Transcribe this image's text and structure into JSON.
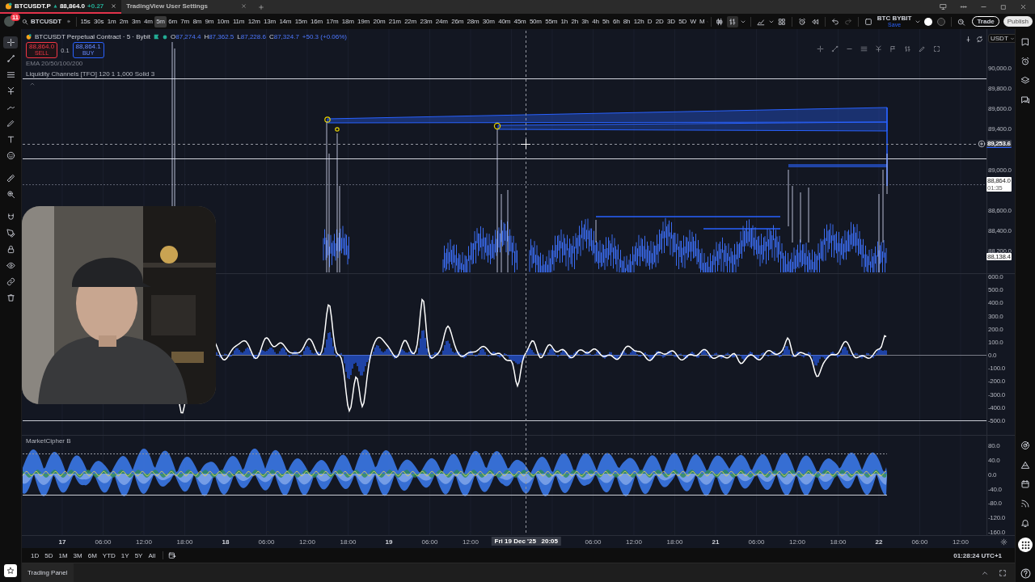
{
  "browser_tabs": [
    {
      "label": "BTCUSDT.P",
      "price": "88,864.0",
      "change": "+0.27",
      "selected": true
    },
    {
      "label": "TradingView User Settings",
      "selected": false
    }
  ],
  "toolbar": {
    "notification_count": "11",
    "symbol": "BTCUSDT",
    "intervals": [
      {
        "label": "15s",
        "selected": false
      },
      {
        "label": "30s",
        "selected": false
      },
      {
        "label": "1m",
        "selected": false
      },
      {
        "label": "2m",
        "selected": false
      },
      {
        "label": "3m",
        "selected": false
      },
      {
        "label": "4m",
        "selected": false
      },
      {
        "label": "5m",
        "selected": true
      },
      {
        "label": "6m",
        "selected": false
      },
      {
        "label": "7m",
        "selected": false
      },
      {
        "label": "8m",
        "selected": false
      },
      {
        "label": "9m",
        "selected": false
      },
      {
        "label": "10m",
        "selected": false
      },
      {
        "label": "11m",
        "selected": false
      },
      {
        "label": "12m",
        "selected": false
      },
      {
        "label": "13m",
        "selected": false
      },
      {
        "label": "14m",
        "selected": false
      },
      {
        "label": "15m",
        "selected": false
      },
      {
        "label": "16m",
        "selected": false
      },
      {
        "label": "17m",
        "selected": false
      },
      {
        "label": "18m",
        "selected": false
      },
      {
        "label": "19m",
        "selected": false
      },
      {
        "label": "20m",
        "selected": false
      },
      {
        "label": "21m",
        "selected": false
      },
      {
        "label": "22m",
        "selected": false
      },
      {
        "label": "23m",
        "selected": false
      },
      {
        "label": "24m",
        "selected": false
      },
      {
        "label": "26m",
        "selected": false
      },
      {
        "label": "28m",
        "selected": false
      },
      {
        "label": "30m",
        "selected": false
      },
      {
        "label": "40m",
        "selected": false
      },
      {
        "label": "45m",
        "selected": false
      },
      {
        "label": "50m",
        "selected": false
      },
      {
        "label": "55m",
        "selected": false
      },
      {
        "label": "1h",
        "selected": false
      },
      {
        "label": "2h",
        "selected": false
      },
      {
        "label": "3h",
        "selected": false
      },
      {
        "label": "4h",
        "selected": false
      },
      {
        "label": "5h",
        "selected": false
      },
      {
        "label": "6h",
        "selected": false
      },
      {
        "label": "8h",
        "selected": false
      },
      {
        "label": "12h",
        "selected": false
      },
      {
        "label": "D",
        "selected": false
      },
      {
        "label": "2D",
        "selected": false
      },
      {
        "label": "3D",
        "selected": false
      },
      {
        "label": "5D",
        "selected": false
      },
      {
        "label": "W",
        "selected": false
      },
      {
        "label": "M",
        "selected": false
      }
    ],
    "layout_name": "BTC BYBIT",
    "layout_status": "Save",
    "trade": "Trade",
    "publish": "Publish"
  },
  "drawing_tools": [
    {
      "kind": "crosshair",
      "selected": true
    },
    {
      "kind": "trend-line",
      "selected": false
    },
    {
      "kind": "lines",
      "selected": false
    },
    {
      "kind": "fork",
      "selected": false
    },
    {
      "kind": "brush",
      "selected": false
    },
    {
      "kind": "pencil",
      "selected": false
    },
    {
      "kind": "text",
      "selected": false
    },
    {
      "kind": "smiley",
      "selected": false
    },
    {
      "kind": "ruler",
      "selected": false
    },
    {
      "kind": "zoom",
      "selected": false
    },
    {
      "kind": "magnet",
      "selected": false
    },
    {
      "kind": "pen",
      "selected": false
    },
    {
      "kind": "lock",
      "selected": false
    },
    {
      "kind": "eye",
      "selected": false
    },
    {
      "kind": "link",
      "selected": false
    },
    {
      "kind": "trash",
      "selected": false
    }
  ],
  "legend": {
    "title": "BTCUSDT Perpetual Contract · 5 · Bybit",
    "ohlc": [
      {
        "key": "O",
        "value": "87,274.4"
      },
      {
        "key": "H",
        "value": "87,362.5"
      },
      {
        "key": "L",
        "value": "87,228.6"
      },
      {
        "key": "C",
        "value": "87,324.7"
      }
    ],
    "change": "+50.3 (+0.06%)",
    "sell_price": "88,864.0",
    "sell_label": "SELL",
    "quantity": "0.1",
    "buy_price": "88,864.1",
    "buy_label": "BUY",
    "indicators": [
      "EMA 20/50/100/200",
      "Liquidity Channels [TFO] 120 1 1,000 Solid 3"
    ]
  },
  "price_axis": {
    "currency": "USDT",
    "panes": [
      {
        "ticks": [
          "90,000.0",
          "89,800.0",
          "89,600.0",
          "89,400.0",
          "89,000.0",
          "88,600.0",
          "88,400.0",
          "88,200.0"
        ],
        "markers": [
          {
            "price": "89,253.6",
            "kind": "crosshair"
          },
          {
            "price": "88,864.0",
            "countdown": "01:35",
            "kind": "last"
          },
          {
            "price": "88,138.4",
            "kind": "level"
          }
        ]
      },
      {
        "ticks": [
          "600.0",
          "500.0",
          "400.0",
          "300.0",
          "200.0",
          "100.0",
          "0.0",
          "-100.0",
          "-200.0",
          "-300.0",
          "-400.0",
          "-500.0"
        ]
      },
      {
        "ticks": [
          "80.0",
          "40.0",
          "0.0",
          "-40.0",
          "-80.0",
          "-120.0",
          "-160.0"
        ]
      }
    ]
  },
  "indicator_pane": {
    "title": "MarketCipher B"
  },
  "time_axis": [
    {
      "text": "17",
      "kind": "day"
    },
    {
      "text": "06:00",
      "kind": "time"
    },
    {
      "text": "12:00",
      "kind": "time"
    },
    {
      "text": "18:00",
      "kind": "time"
    },
    {
      "text": "18",
      "kind": "day"
    },
    {
      "text": "06:00",
      "kind": "time"
    },
    {
      "text": "12:00",
      "kind": "time"
    },
    {
      "text": "18:00",
      "kind": "time"
    },
    {
      "text": "19",
      "kind": "day"
    },
    {
      "text": "06:00",
      "kind": "time"
    },
    {
      "text": "12:00",
      "kind": "time"
    },
    {
      "text": "Fri 19 Dec '25   20:05",
      "kind": "crosshair"
    },
    {
      "text": "06:00",
      "kind": "time"
    },
    {
      "text": "12:00",
      "kind": "time"
    },
    {
      "text": "18:00",
      "kind": "time"
    },
    {
      "text": "21",
      "kind": "day"
    },
    {
      "text": "06:00",
      "kind": "time"
    },
    {
      "text": "12:00",
      "kind": "time"
    },
    {
      "text": "18:00",
      "kind": "time"
    },
    {
      "text": "22",
      "kind": "day"
    },
    {
      "text": "06:00",
      "kind": "time"
    },
    {
      "text": "12:00",
      "kind": "time"
    }
  ],
  "range_bar": {
    "ranges": [
      "1D",
      "5D",
      "1M",
      "3M",
      "6M",
      "YTD",
      "1Y",
      "5Y",
      "All"
    ],
    "clock": "01:28:24 UTC+1"
  },
  "trading_panel": {
    "title": "Trading Panel"
  }
}
